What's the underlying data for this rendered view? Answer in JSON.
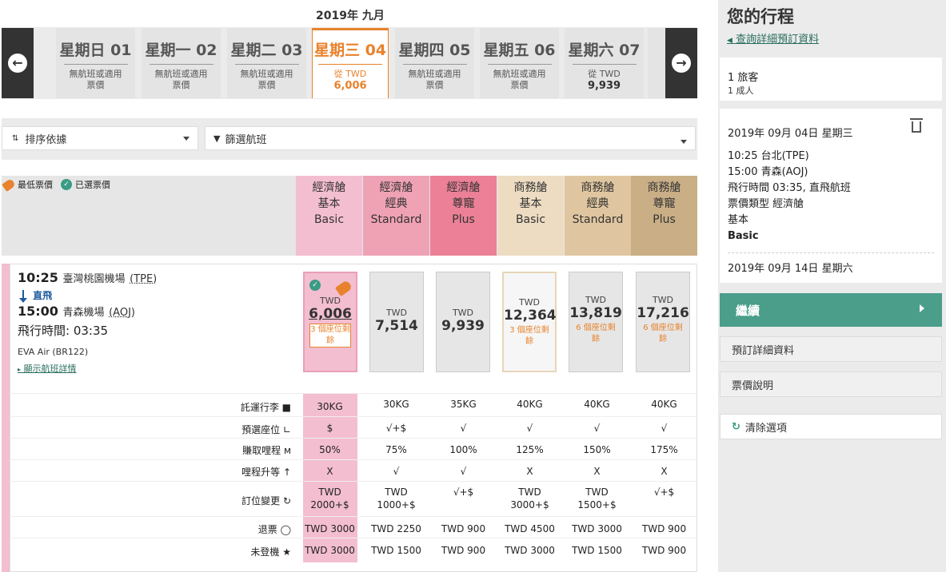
{
  "header": {
    "month": "2019年 九月"
  },
  "days": [
    {
      "label": "星期日 01",
      "sub1": "無航班或適用",
      "sub2": "票價"
    },
    {
      "label": "星期一 02",
      "sub1": "無航班或適用",
      "sub2": "票價"
    },
    {
      "label": "星期二 03",
      "sub1": "無航班或適用",
      "sub2": "票價"
    },
    {
      "label": "星期三 04",
      "sub1": "從 TWD",
      "sub2": "6,006"
    },
    {
      "label": "星期四 05",
      "sub1": "無航班或適用",
      "sub2": "票價"
    },
    {
      "label": "星期五 06",
      "sub1": "無航班或適用",
      "sub2": "票價"
    },
    {
      "label": "星期六 07",
      "sub1": "從 TWD",
      "sub2": "9,939"
    }
  ],
  "controls": {
    "sort_label": "排序依據",
    "filter_label": "篩選航班"
  },
  "legend": {
    "lowest": "最低票價",
    "selected": "已選票價"
  },
  "fare_classes": [
    {
      "line1": "經濟艙",
      "line2": "基本",
      "line3": "Basic",
      "color": "#f3bed0"
    },
    {
      "line1": "經濟艙",
      "line2": "經典",
      "line3": "Standard",
      "color": "#efa2b4"
    },
    {
      "line1": "經濟艙",
      "line2": "尊寵",
      "line3": "Plus",
      "color": "#eb8096"
    },
    {
      "line1": "商務艙",
      "line2": "基本",
      "line3": "Basic",
      "color": "#eddcc2"
    },
    {
      "line1": "商務艙",
      "line2": "經典",
      "line3": "Standard",
      "color": "#e0c6a0"
    },
    {
      "line1": "商務艙",
      "line2": "尊寵",
      "line3": "Plus",
      "color": "#c9ae86"
    }
  ],
  "flight": {
    "dep_time": "10:25",
    "dep_airport": "臺灣桃園機場",
    "dep_code": "(TPE)",
    "direct": "直飛",
    "arr_time": "15:00",
    "arr_airport": "青森機場",
    "arr_code": "(AOJ)",
    "duration": "飛行時間: 03:35",
    "airline": "EVA Air (BR122)",
    "details_link": "顯示航班詳情"
  },
  "fares": [
    {
      "currency": "TWD",
      "amount": "6,006",
      "seats": "3 個座位剩餘"
    },
    {
      "currency": "TWD",
      "amount": "7,514",
      "seats": ""
    },
    {
      "currency": "TWD",
      "amount": "9,939",
      "seats": ""
    },
    {
      "currency": "TWD",
      "amount": "12,364",
      "seats": "3 個座位剩餘"
    },
    {
      "currency": "TWD",
      "amount": "13,819",
      "seats": "6 個座位剩餘"
    },
    {
      "currency": "TWD",
      "amount": "17,216",
      "seats": "6 個座位剩餘"
    }
  ],
  "features": [
    {
      "label": "託運行李",
      "icon": "suitcase-icon",
      "values": [
        "30KG",
        "30KG",
        "35KG",
        "40KG",
        "40KG",
        "40KG"
      ]
    },
    {
      "label": "預選座位",
      "icon": "seat-icon",
      "values": [
        "$",
        "√+$",
        "√",
        "√",
        "√",
        "√"
      ]
    },
    {
      "label": "賺取哩程",
      "icon": "miles-icon",
      "values": [
        "50%",
        "75%",
        "100%",
        "125%",
        "150%",
        "175%"
      ]
    },
    {
      "label": "哩程升等",
      "icon": "upgrade-icon",
      "values": [
        "X",
        "√",
        "√",
        "X",
        "X",
        "X"
      ]
    },
    {
      "label": "訂位變更",
      "icon": "change-icon",
      "values": [
        "TWD 2000+$",
        "TWD 1000+$",
        "√+$",
        "TWD 3000+$",
        "TWD 1500+$",
        "√+$"
      ]
    },
    {
      "label": "退票",
      "icon": "refund-icon",
      "values": [
        "TWD 3000",
        "TWD 2250",
        "TWD 900",
        "TWD 4500",
        "TWD 3000",
        "TWD 900"
      ]
    },
    {
      "label": "未登機",
      "icon": "noshow-icon",
      "values": [
        "TWD 3000",
        "TWD 1500",
        "TWD 900",
        "TWD 3000",
        "TWD 1500",
        "TWD 900"
      ]
    }
  ],
  "side": {
    "title": "您的行程",
    "link": "查詢詳細預訂資料",
    "travellers_count": "1 旅客",
    "travellers_detail": "1 成人",
    "trip_date": "2019年 09月 04日 星期三",
    "trip_dep": "10:25 台北(TPE)",
    "trip_arr": "15:00 青森(AOJ)",
    "trip_duration": "飛行時間 03:35, 直飛航班",
    "trip_fare_type": "票價類型 經濟艙",
    "trip_fare_sub": "基本",
    "trip_fare_name": "Basic",
    "return_date": "2019年 09月 14日 星期六",
    "continue": "繼續",
    "booking_details": "預訂詳細資料",
    "fare_rules": "票價說明",
    "clear": "清除選項"
  }
}
